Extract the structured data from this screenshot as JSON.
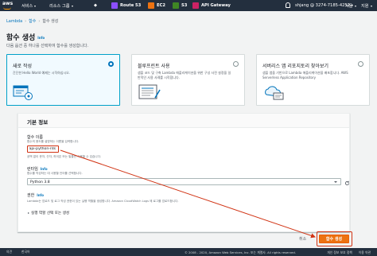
{
  "nav": {
    "services": "서비스",
    "resource_groups": "리소스 그룹",
    "pinned": [
      {
        "label": "Route 53",
        "icon": "route53-icon",
        "color": "#8c4fff"
      },
      {
        "label": "EC2",
        "icon": "ec2-icon",
        "color": "#ec7211"
      },
      {
        "label": "S3",
        "icon": "s3-icon",
        "color": "#3f8624"
      },
      {
        "label": "API Gateway",
        "icon": "api-gateway-icon",
        "color": "#cc2264"
      }
    ],
    "account": "shjang @ 3274-7185-4252",
    "region": "서울",
    "support": "지원"
  },
  "breadcrumb": {
    "root": "Lambda",
    "mid": "함수",
    "current": "함수 생성"
  },
  "page": {
    "title": "함수 생성",
    "info": "Info",
    "description": "다음 옵션 중 하나를 선택하여 함수를 생성합니다."
  },
  "options": [
    {
      "title": "새로 작성",
      "desc": "간단한 Hello World 예제는 시작하십시오.",
      "selected": true
    },
    {
      "title": "블루프린트 사용",
      "desc": "샘플 코드 및 구축 Lambda 애플리케이션을 위한 구성 사전 설정을 일반적인 사용 사례를 시작합니다.",
      "selected": false
    },
    {
      "title": "서버리스 앱 리포지토리 찾아보기",
      "desc": "샘플 앱을 기반으로 Lambda 애플리케이션을 배포합니다. AWS Serverless Application Repository",
      "selected": false
    }
  ],
  "basic": {
    "header": "기본 정보",
    "fn_label": "함수 이름",
    "fn_hint": "함수의 용도를 설명하는 이름을 입력합니다.",
    "fn_value": "api-python-rds",
    "fn_constraint": "공백 없이 문자, 숫자, 하이픈 또는 밑줄만 사용할 수 있습니다.",
    "runtime_label": "런타임",
    "runtime_info": "Info",
    "runtime_hint": "함수를 작성하는 데 사용할 언어를 선택합니다.",
    "runtime_value": "Python 3.8",
    "perm_label": "권한",
    "perm_info": "Info",
    "perm_hint": "Lambda는 업로드 및 로그 작성 권한이 있는 실행 역할을 생성합니다. Amazon CloudWatch Logs 에 로그를 업로드합니다.",
    "expander": "실행 역할 선택 또는 생성"
  },
  "actions": {
    "cancel": "취소",
    "create": "함수 생성"
  },
  "footer": {
    "feedback": "의견",
    "language": "한국어",
    "copyright": "© 2008 - 2020, Amazon Web Services, Inc. 또는 계열사. All rights reserved.",
    "privacy": "개인 정보 보호 정책",
    "terms": "이용 약관"
  }
}
